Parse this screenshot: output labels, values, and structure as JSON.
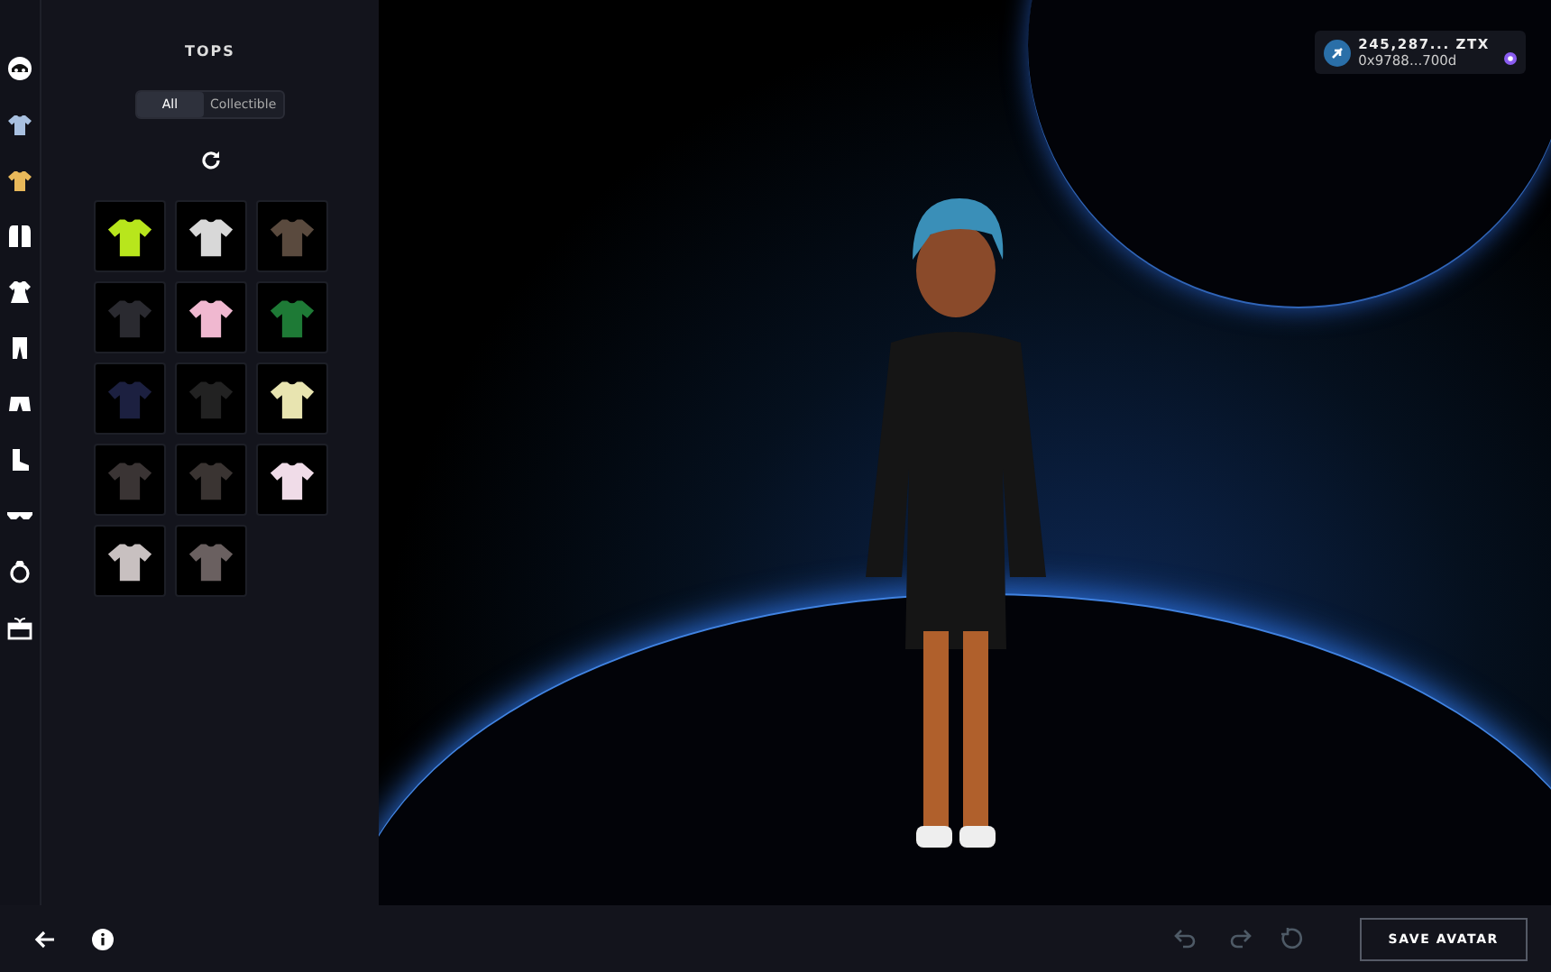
{
  "categories": [
    {
      "kind": "face",
      "selected": false
    },
    {
      "kind": "shirt",
      "selected": false
    },
    {
      "kind": "shirt",
      "selected": true
    },
    {
      "kind": "jacket",
      "selected": false
    },
    {
      "kind": "dress",
      "selected": false
    },
    {
      "kind": "pants",
      "selected": false
    },
    {
      "kind": "shorts",
      "selected": false
    },
    {
      "kind": "boot",
      "selected": false
    },
    {
      "kind": "glasses",
      "selected": false
    },
    {
      "kind": "ring",
      "selected": false
    },
    {
      "kind": "gift",
      "selected": false
    }
  ],
  "panel": {
    "title": "TOPS",
    "filters": [
      {
        "label": "All",
        "selected": true
      },
      {
        "label": "Collectible",
        "selected": false
      }
    ],
    "items": [
      {
        "color": "#b8e61c"
      },
      {
        "color": "#d8d8d8"
      },
      {
        "color": "#5a4a3e"
      },
      {
        "color": "#2a2a30"
      },
      {
        "color": "#f0b8d0"
      },
      {
        "color": "#1e7a36"
      },
      {
        "color": "#1c2040"
      },
      {
        "color": "#222222"
      },
      {
        "color": "#e8e4b0"
      },
      {
        "color": "#3a3434"
      },
      {
        "color": "#3a3432"
      },
      {
        "color": "#f0dce8"
      },
      {
        "color": "#c8c0c0"
      },
      {
        "color": "#6a6060"
      }
    ]
  },
  "wallet": {
    "balance": "245,287... ZTX",
    "address": "0x9788...700d"
  },
  "toolbar": {
    "history": [
      {
        "kind": "undo",
        "disabled": true
      },
      {
        "kind": "redo",
        "disabled": true
      },
      {
        "kind": "reset",
        "disabled": true
      }
    ],
    "save": "SAVE AVATAR"
  }
}
